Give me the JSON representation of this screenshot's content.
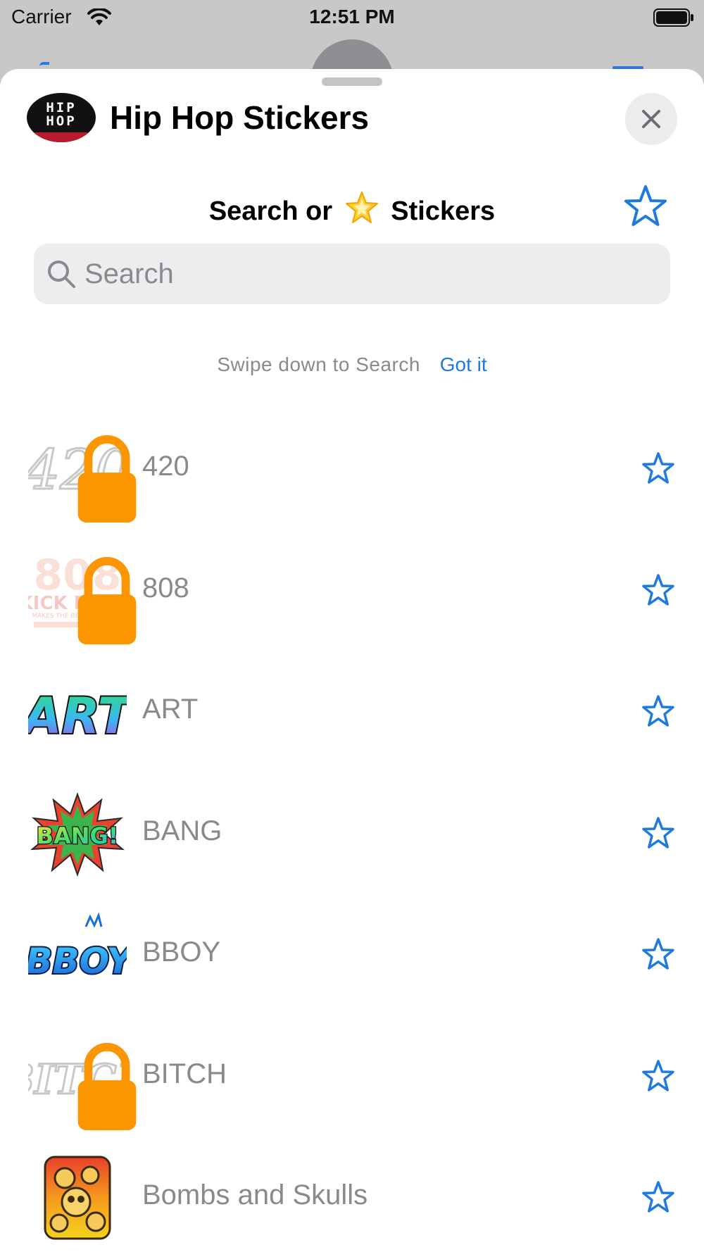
{
  "status_bar": {
    "carrier": "Carrier",
    "time": "12:51 PM",
    "wifi_icon": "wifi-icon",
    "battery_icon": "battery-full-icon"
  },
  "app": {
    "title": "Hip Hop Stickers",
    "logo_text": "HIP HOP",
    "close_icon": "close-icon"
  },
  "search": {
    "heading_prefix": "Search or",
    "heading_suffix": "Stickers",
    "heading_icon": "glowing-star-emoji",
    "placeholder": "Search",
    "value": ""
  },
  "hint": {
    "text": "Swipe down to Search",
    "action": "Got it"
  },
  "stickers": [
    {
      "label": "420",
      "locked": true,
      "thumb": "graffiti-420"
    },
    {
      "label": "808",
      "locked": true,
      "thumb": "808-kick-drum"
    },
    {
      "label": "ART",
      "locked": false,
      "thumb": "graffiti-art"
    },
    {
      "label": "BANG",
      "locked": false,
      "thumb": "bang-burst"
    },
    {
      "label": "BBOY",
      "locked": false,
      "thumb": "graffiti-bboy"
    },
    {
      "label": "BITCH",
      "locked": true,
      "thumb": "graffiti-bitch"
    },
    {
      "label": "Bombs and Skulls",
      "locked": false,
      "thumb": "bombs-and-skulls"
    }
  ],
  "colors": {
    "accent": "#1f7ae0",
    "lock": "#fb9500",
    "label": "#8a8a8e"
  }
}
